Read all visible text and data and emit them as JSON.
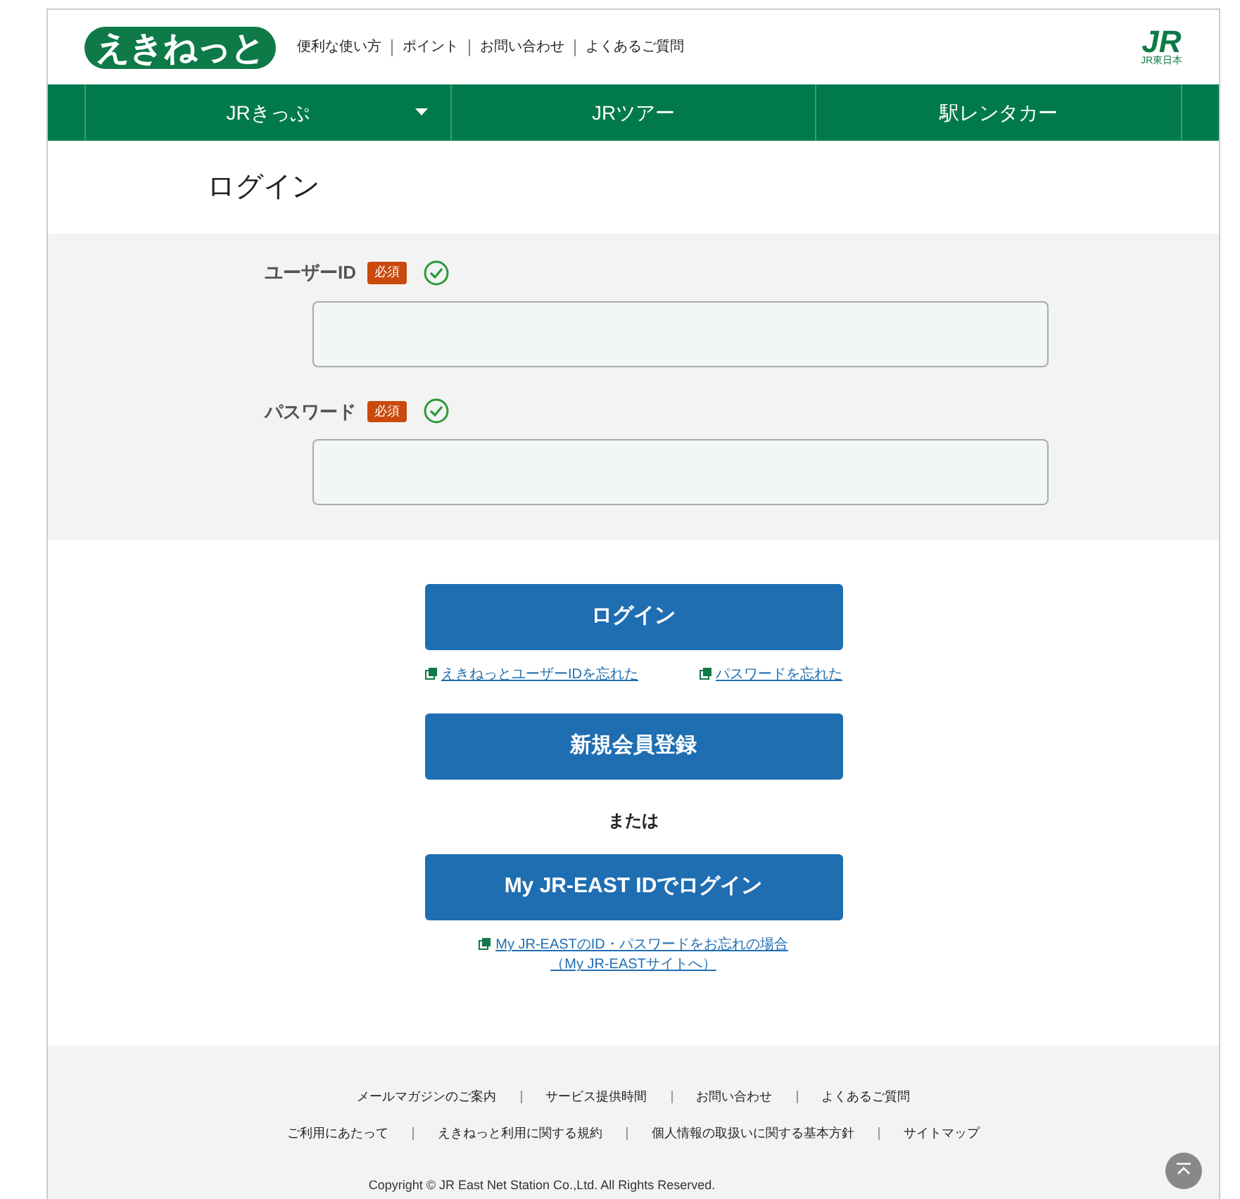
{
  "header": {
    "logo": "えきねっと",
    "links": [
      "便利な使い方",
      "ポイント",
      "お問い合わせ",
      "よくあるご質問"
    ],
    "brand": {
      "mark": "JR",
      "name": "JR東日本"
    }
  },
  "nav": [
    {
      "label": "JRきっぷ",
      "dropdown": true
    },
    {
      "label": "JRツアー",
      "dropdown": false
    },
    {
      "label": "駅レンタカー",
      "dropdown": false
    }
  ],
  "page_title": "ログイン",
  "fields": [
    {
      "label": "ユーザーID",
      "required": "必須"
    },
    {
      "label": "パスワード",
      "required": "必須"
    }
  ],
  "login_button": "ログイン",
  "forgot_links": [
    "えきねっとユーザーIDを忘れた",
    "パスワードを忘れた"
  ],
  "register_button": "新規会員登録",
  "or_text": "または",
  "jr_east_button": "My JR-EAST IDでログイン",
  "jr_east_forgot": [
    "My JR-EASTのID・パスワードをお忘れの場合",
    "（My JR-EASTサイトへ）"
  ],
  "footer": {
    "rows": [
      [
        "メールマガジンのご案内",
        "サービス提供時間",
        "お問い合わせ",
        "よくあるご質問"
      ],
      [
        "ご利用にあたって",
        "えきねっと利用に関する規約",
        "個人情報の取扱いに関する基本方針",
        "サイトマップ"
      ]
    ],
    "copyright": "Copyright © JR East Net Station Co.,Ltd. All Rights Reserved."
  }
}
